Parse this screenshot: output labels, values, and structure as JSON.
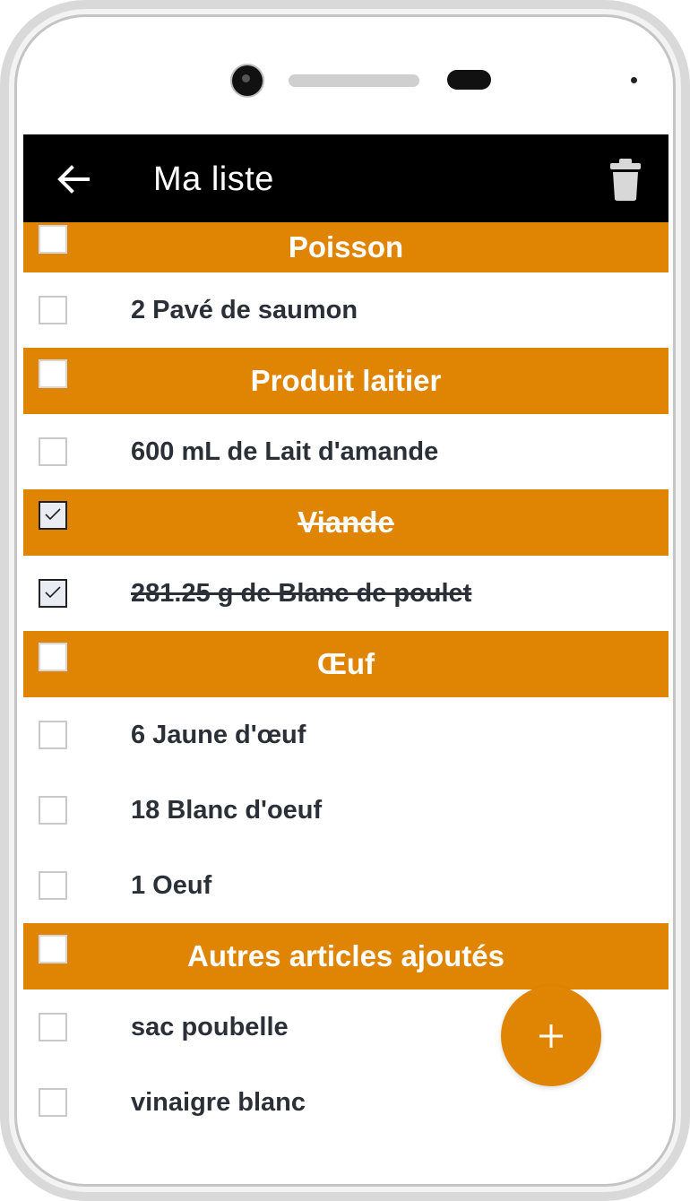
{
  "app": {
    "title": "Ma liste"
  },
  "colors": {
    "accent": "#e08503",
    "appbar": "#000000",
    "text": "#2b2f38"
  },
  "icons": {
    "back": "arrow-left-icon",
    "delete": "trash-icon",
    "add": "plus-icon"
  },
  "list": [
    {
      "category": "Poisson",
      "checked": false,
      "items": [
        {
          "label": "2 Pavé de saumon",
          "checked": false
        }
      ]
    },
    {
      "category": "Produit laitier",
      "checked": false,
      "items": [
        {
          "label": "600 mL de Lait d'amande",
          "checked": false
        }
      ]
    },
    {
      "category": "Viande",
      "checked": true,
      "items": [
        {
          "label": "281.25 g de Blanc de poulet",
          "checked": true
        }
      ]
    },
    {
      "category": "Œuf",
      "checked": false,
      "items": [
        {
          "label": "6 Jaune d'œuf",
          "checked": false
        },
        {
          "label": "18 Blanc d'oeuf",
          "checked": false
        },
        {
          "label": "1 Oeuf",
          "checked": false
        }
      ]
    },
    {
      "category": "Autres articles ajoutés",
      "checked": false,
      "items": [
        {
          "label": "sac poubelle",
          "checked": false
        },
        {
          "label": "vinaigre blanc",
          "checked": false
        }
      ]
    }
  ]
}
